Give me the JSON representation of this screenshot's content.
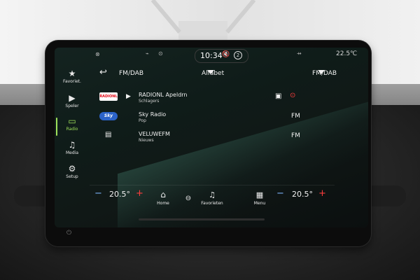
{
  "status_bar": {
    "time": "10:34",
    "notification_count": "2",
    "outside_temp": "22.5℃"
  },
  "sidebar": {
    "items": [
      {
        "label": "Favoriet.",
        "icon": "star-icon"
      },
      {
        "label": "Speler",
        "icon": "play-icon"
      },
      {
        "label": "Radio",
        "icon": "radio-icon",
        "active": true
      },
      {
        "label": "Media",
        "icon": "music-note-icon"
      },
      {
        "label": "Setup",
        "icon": "gears-icon"
      }
    ]
  },
  "header": {
    "title": "FM/DAB",
    "sort_label": "Alfabet",
    "source_label": "FM/DAB"
  },
  "stations": [
    {
      "logo": "RADIONL",
      "name": "RADIONL Apeldrn",
      "genre": "Schlagers",
      "type": "",
      "playing": true
    },
    {
      "logo": "Sky",
      "name": "Sky Radio",
      "genre": "Pop",
      "type": "FM",
      "playing": false
    },
    {
      "logo": "",
      "name": "VELUWEFM",
      "genre": "Nieuws",
      "type": "FM",
      "playing": false
    }
  ],
  "bottom_bar": {
    "left_temp": "20.5°",
    "right_temp": "20.5°",
    "home_label": "Home",
    "favorites_label": "Favorieten",
    "menu_label": "Menu"
  },
  "colors": {
    "accent": "#9fe05a",
    "temp_plus": "#ff3d3d",
    "temp_minus": "#7fb6ff",
    "radionl_logo": "#e30613"
  }
}
